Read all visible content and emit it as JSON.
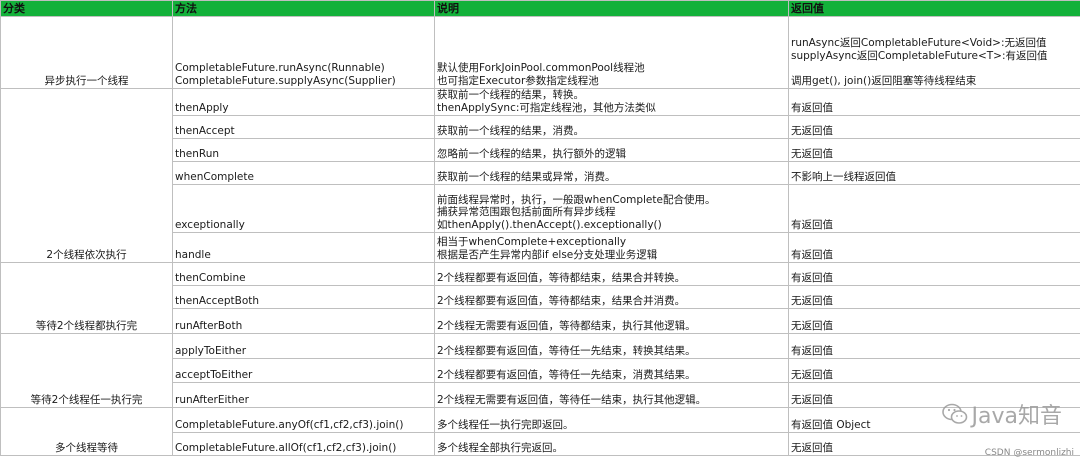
{
  "headers": [
    "分类",
    "方法",
    "说明",
    "返回值"
  ],
  "rows": [
    {
      "cat": "异步执行一个线程",
      "span": 1,
      "h": 72,
      "method": [
        "CompletableFuture.runAsync(Runnable)",
        "CompletableFuture.supplyAsync(Supplier)"
      ],
      "desc": [
        "默认使用ForkJoinPool.commonPool线程池",
        "也可指定Executor参数指定线程池"
      ],
      "ret": [
        "runAsync返回CompletableFuture<Void>:无返回值",
        "supplyAsync返回CompletableFuture<T>:有返回值",
        "",
        "调用get(), join()返回阻塞等待线程结束"
      ]
    },
    {
      "cat": "2个线程依次执行",
      "span": 6,
      "h": 23,
      "method": [
        "thenApply"
      ],
      "desc": [
        "获取前一个线程的结果，转换。",
        "thenApplySync:可指定线程池，其他方法类似"
      ],
      "ret": [
        "有返回值"
      ]
    },
    {
      "h": 23,
      "method": [
        "thenAccept"
      ],
      "desc": [
        "获取前一个线程的结果，消费。"
      ],
      "ret": [
        "无返回值"
      ]
    },
    {
      "h": 23,
      "method": [
        "thenRun"
      ],
      "desc": [
        "忽略前一个线程的结果，执行额外的逻辑"
      ],
      "ret": [
        "无返回值"
      ]
    },
    {
      "h": 23,
      "method": [
        "whenComplete"
      ],
      "desc": [
        "获取前一个线程的结果或异常，消费。"
      ],
      "ret": [
        "不影响上一线程返回值"
      ]
    },
    {
      "h": 48,
      "method": [
        "exceptionally"
      ],
      "desc": [
        "前面线程异常时，执行，一般跟whenComplete配合使用。",
        "捕获异常范围跟包括前面所有异步线程",
        "如thenApply().thenAccept().exceptionally()"
      ],
      "ret": [
        "有返回值"
      ]
    },
    {
      "h": 30,
      "method": [
        "handle"
      ],
      "desc": [
        "相当于whenComplete+exceptionally",
        "根据是否产生异常内部if else分支处理业务逻辑"
      ],
      "ret": [
        "有返回值"
      ]
    },
    {
      "cat": "等待2个线程都执行完",
      "span": 3,
      "h": 23,
      "method": [
        "thenCombine"
      ],
      "desc": [
        "2个线程都要有返回值，等待都结束，结果合并转换。"
      ],
      "ret": [
        "有返回值"
      ]
    },
    {
      "h": 23,
      "method": [
        "thenAcceptBoth"
      ],
      "desc": [
        "2个线程都要有返回值，等待都结束，结果合并消费。"
      ],
      "ret": [
        "无返回值"
      ]
    },
    {
      "h": 25,
      "method": [
        "runAfterBoth"
      ],
      "desc": [
        "2个线程无需要有返回值，等待都结束，执行其他逻辑。"
      ],
      "ret": [
        "无返回值"
      ]
    },
    {
      "cat": "等待2个线程任一执行完",
      "span": 3,
      "h": 25,
      "method": [
        "applyToEither"
      ],
      "desc": [
        "2个线程都要有返回值，等待任一先结束，转换其结果。"
      ],
      "ret": [
        "有返回值"
      ]
    },
    {
      "h": 24,
      "method": [
        "acceptToEither"
      ],
      "desc": [
        "2个线程都要有返回值，等待任一先结束，消费其结果。"
      ],
      "ret": [
        "无返回值"
      ]
    },
    {
      "h": 25,
      "method": [
        "runAfterEither"
      ],
      "desc": [
        "2个线程无需要有返回值，等待任一结束，执行其他逻辑。"
      ],
      "ret": [
        "无返回值"
      ]
    },
    {
      "cat": "多个线程等待",
      "span": 2,
      "h": 25,
      "method": [
        "CompletableFuture.anyOf(cf1,cf2,cf3).join()"
      ],
      "desc": [
        "多个线程任一执行完即返回。"
      ],
      "ret": [
        "有返回值 Object"
      ]
    },
    {
      "h": 23,
      "method": [
        "CompletableFuture.allOf(cf1,cf2,cf3).join()"
      ],
      "desc": [
        "多个线程全部执行完返回。"
      ],
      "ret": [
        "无返回值"
      ]
    }
  ],
  "watermark": {
    "text": "Java知音",
    "icon": "wechat-icon",
    "credit": "CSDN @sermonlizhi"
  }
}
